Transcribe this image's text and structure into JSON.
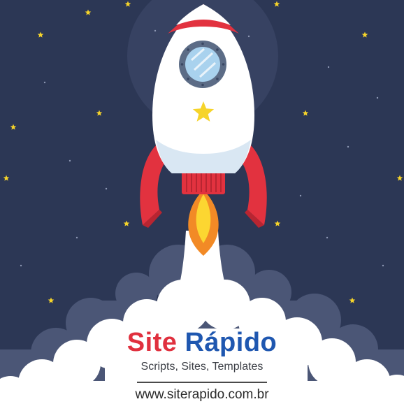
{
  "brand": {
    "name_part1": "Site",
    "name_part2": "Rápido",
    "tagline": "Scripts, Sites, Templates",
    "url": "www.siterapido.com.br"
  },
  "colors": {
    "background": "#2c3755",
    "glow": "#3a4666",
    "cloud_back": "#4b5676",
    "cloud_front": "#ffffff",
    "rocket_body": "#ffffff",
    "rocket_red": "#e2323f",
    "window_frame": "#5c6c86",
    "window_glass": "#a9d2ee",
    "star": "#f6d42a",
    "flame_outer": "#f28a26",
    "flame_inner": "#fcd631",
    "brand_red": "#e0303e",
    "brand_blue": "#1f57b0"
  },
  "icons": {
    "rocket": "rocket-icon",
    "star": "star-icon"
  }
}
